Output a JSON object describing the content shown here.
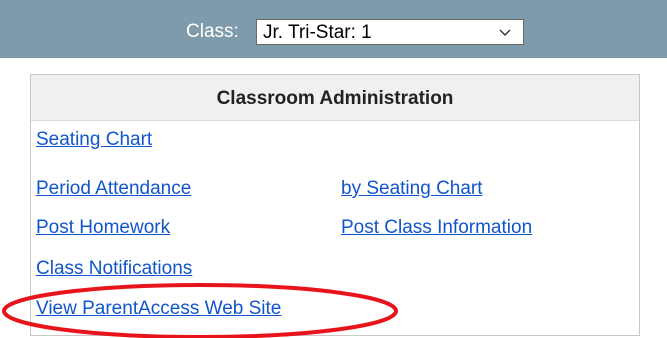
{
  "header": {
    "class_label": "Class:",
    "class_select_value": "Jr. Tri-Star: 1"
  },
  "panel": {
    "title": "Classroom Administration",
    "links": {
      "seating_chart": "Seating Chart",
      "period_attendance": "Period Attendance",
      "by_seating_chart": "by Seating Chart",
      "post_homework": "Post Homework",
      "post_class_information": "Post Class Information",
      "class_notifications": "Class Notifications",
      "view_parentaccess_web_site": "View ParentAccess Web Site"
    }
  },
  "colors": {
    "header_bar": "#7f9bab",
    "link": "#1155cc",
    "annotation_ellipse": "#e8141c"
  },
  "icons": {
    "select_arrow": "chevron-down-icon"
  }
}
